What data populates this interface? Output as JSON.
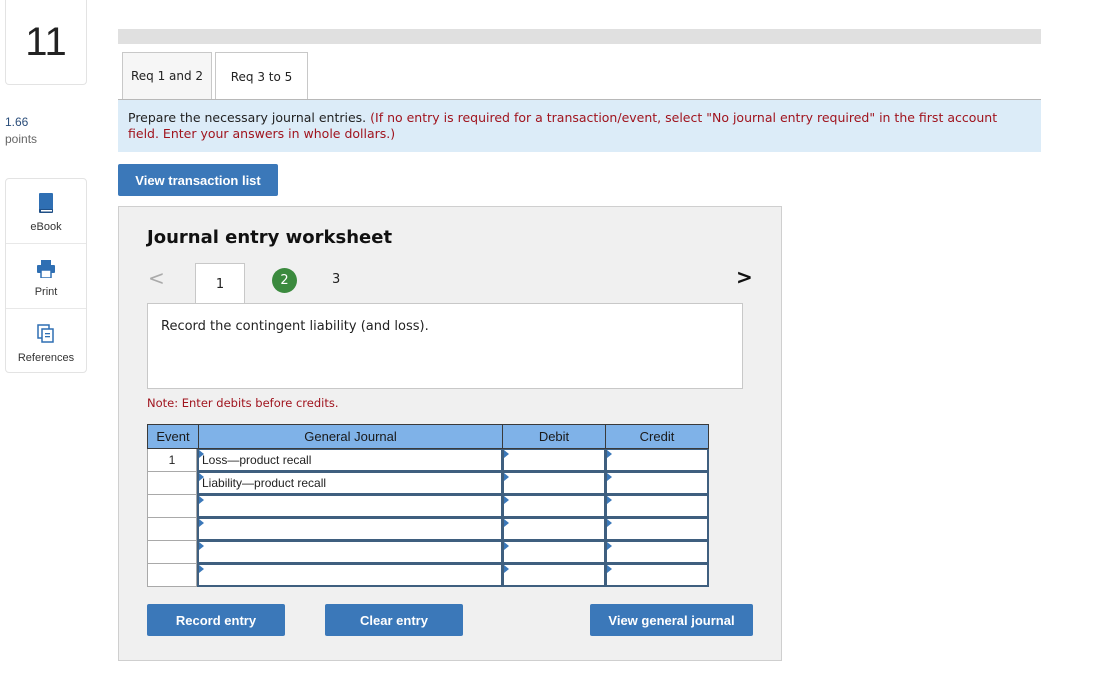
{
  "question": {
    "number": "11",
    "points_value": "1.66",
    "points_label": "points"
  },
  "tools": [
    {
      "label": "eBook",
      "icon": "book-icon"
    },
    {
      "label": "Print",
      "icon": "printer-icon"
    },
    {
      "label": "References",
      "icon": "copy-pages-icon"
    }
  ],
  "tabs": [
    {
      "label": "Req 1 and 2",
      "active": false
    },
    {
      "label": "Req 3 to 5",
      "active": true
    }
  ],
  "instruction": {
    "main": "Prepare the necessary journal entries.",
    "note": "(If no entry is required for a transaction/event, select \"No journal entry required\" in the first account field. Enter your answers in whole dollars.)"
  },
  "view_transaction_list": "View transaction list",
  "worksheet": {
    "title": "Journal entry worksheet",
    "prev": "<",
    "next": ">",
    "steps": [
      "1",
      "2",
      "3"
    ],
    "current_step": "1",
    "completed_step": "2",
    "description": "Record the contingent liability (and loss).",
    "note": "Note: Enter debits before credits.",
    "table": {
      "headers": [
        "Event",
        "General Journal",
        "Debit",
        "Credit"
      ],
      "rows": [
        {
          "event": "1",
          "account": "Loss—product recall",
          "debit": "",
          "credit": ""
        },
        {
          "event": "",
          "account": "Liability—product recall",
          "debit": "",
          "credit": ""
        },
        {
          "event": "",
          "account": "",
          "debit": "",
          "credit": ""
        },
        {
          "event": "",
          "account": "",
          "debit": "",
          "credit": ""
        },
        {
          "event": "",
          "account": "",
          "debit": "",
          "credit": ""
        },
        {
          "event": "",
          "account": "",
          "debit": "",
          "credit": ""
        }
      ]
    },
    "buttons": {
      "record": "Record entry",
      "clear": "Clear entry",
      "view_general_journal": "View general journal"
    }
  },
  "colors": {
    "accent_blue": "#3b78b9",
    "header_blue": "#7fb2e8",
    "instruction_bg": "#dcecf8",
    "note_red": "#a0141e",
    "step_green": "#3b8a3e"
  }
}
